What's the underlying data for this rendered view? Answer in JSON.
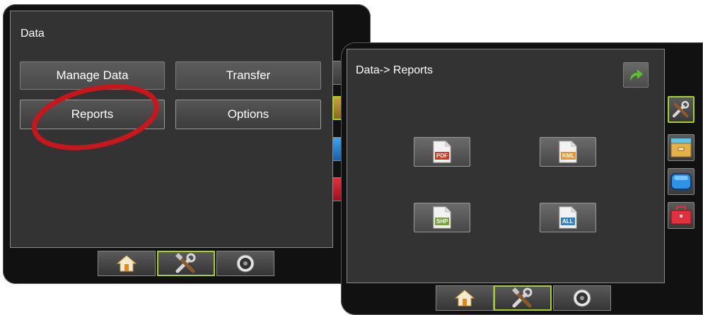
{
  "screen_left": {
    "title": "Data",
    "buttons": {
      "manage_data": "Manage Data",
      "transfer": "Transfer",
      "reports": "Reports",
      "options": "Options"
    },
    "annotation_color": "#c8161d"
  },
  "screen_right": {
    "title": "Data-> Reports",
    "back_icon": "green-return-arrow-icon",
    "reports": [
      {
        "label": "PDF",
        "color": "#d9361e"
      },
      {
        "label": "KML",
        "color": "#e8942a"
      },
      {
        "label": "SHP",
        "color": "#7aa23a"
      },
      {
        "label": "ALL",
        "color": "#3a7fc4"
      }
    ],
    "side_tabs": [
      "tools-icon",
      "folder-icon",
      "monitor-icon",
      "toolbox-icon"
    ],
    "active_side_tab": "tools-icon"
  },
  "bottom_nav": {
    "tabs": [
      "home-icon",
      "tools-icon",
      "gauge-icon"
    ],
    "active": "tools-icon"
  },
  "colors": {
    "active_border": "#a6d12a",
    "screen_bg": "#333333",
    "bezel": "#111111"
  }
}
